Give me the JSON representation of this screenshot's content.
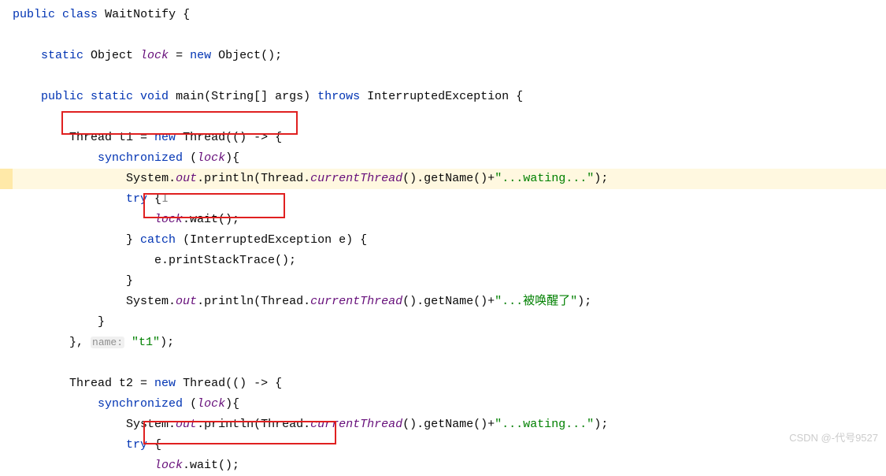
{
  "code": {
    "l1": {
      "public": "public",
      "class": "class",
      "name": "WaitNotify",
      "brace": " {"
    },
    "l2": "",
    "l3": {
      "static": "static",
      "type": " Object",
      "lock": " lock",
      "eq": " = ",
      "new": "new",
      "obj": " Object();"
    },
    "l4": "",
    "l5": {
      "public": "public",
      "static": " static",
      "void": " void",
      "main": " main",
      "params": "(String[] args)",
      "throws": " throws",
      "exc": " InterruptedException {"
    },
    "l6": "",
    "l7": {
      "pre": "Thread t1 = ",
      "new": "new",
      "rest": " Thread(() -> {"
    },
    "l8": {
      "sync": "synchronized",
      "open": " (",
      "lock": "lock",
      "close": "){"
    },
    "l9": {
      "sys": "Syst",
      "e": "e",
      "m": "m.",
      "out": "out",
      "println": ".println(Thread.",
      "ct": "currentThread",
      "rest": "().getName()+",
      "str": "\"...wating...\"",
      "end": ");"
    },
    "l10": {
      "try": "try",
      "brace": " {",
      "cur": "I"
    },
    "l11": {
      "lock": "lock",
      "rest": ".wait();"
    },
    "l12": {
      "close": "} ",
      "catch": "catch",
      "params": " (InterruptedException e) {"
    },
    "l13": "e.printStackTrace();",
    "l14": "}",
    "l15": {
      "sys": "System.",
      "out": "out",
      "println": ".println(Thread.",
      "ct": "currentThread",
      "rest": "().getName()+",
      "str": "\"...被唤醒了\"",
      "end": ");"
    },
    "l16": "}",
    "l17": {
      "close": "}, ",
      "hint": "name:",
      "val": " \"t1\"",
      "end": ");"
    },
    "l18": "",
    "l19": {
      "pre": "Thread t2 = ",
      "new": "new",
      "rest": " Thread(() -> {"
    },
    "l20": {
      "sync": "synchronized",
      "open": " (",
      "lock": "lock",
      "close": "){"
    },
    "l21": {
      "sys": "System.",
      "out": "out",
      "println": ".println(Thread.",
      "ct": "currentThread",
      "rest": "().getName()+",
      "str": "\"...wating...\"",
      "end": ");"
    },
    "l22": {
      "try": "try",
      "brace": " {"
    },
    "l23": {
      "lock": "lock",
      "rest": ".wait();"
    }
  },
  "watermark": "CSDN @-代号9527"
}
